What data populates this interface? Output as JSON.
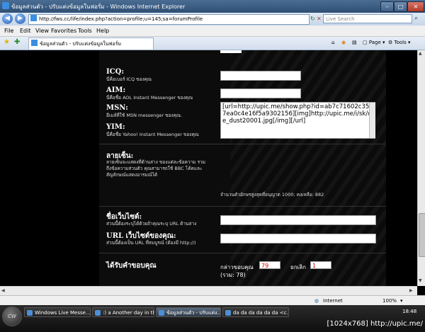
{
  "window": {
    "title": "ข้อมูลส่วนตัว - ปรับแต่งข้อมูลในฟอรั่ม - Windows Internet Explorer"
  },
  "addressbar": {
    "url": "http://fws.cc/life/index.php?action=profile;u=145;sa=forumProfile",
    "search_placeholder": "Live Search"
  },
  "menubar": {
    "items": [
      "File",
      "Edit",
      "View",
      "Favorites",
      "Tools",
      "Help"
    ]
  },
  "tabbar": {
    "tab_title": "ข้อมูลส่วนตัว - ปรับแต่งข้อมูลในฟอรั่ม",
    "page_label": "Page",
    "tools_label": "Tools"
  },
  "form": {
    "icq": {
      "label": "ICQ:",
      "desc": "นี่คือเบอร์ ICQ ของคุณ"
    },
    "aim": {
      "label": "AIM:",
      "desc": "นี่คือชื่อ AOL Instant Messenger ของคุณ"
    },
    "msn": {
      "label": "MSN:",
      "desc": "อีเมล์ที่ใช้ MSN messenger ของคุณ."
    },
    "yim": {
      "label": "YIM:",
      "desc": "นี่คือชื่อ Yahoo! Instant Messenger ของคุณ"
    },
    "signature": {
      "label": "ลายเซ็น:",
      "desc_lines": [
        "ลายเซ็นจะแสดงที่ด้านล่าง ของแต่ละข้อความ รวม",
        "ถึงข้อความส่วนตัว คุณสามารถใช้ BBC โค้ดและ",
        "สัญลักษณ์แสดงอารมณ์ได้"
      ],
      "value": "[url=http://upic.me/show.php?id=ab7c71602c35d7ea0c4e16f5a9302156][img]http://upic.me/i/sk/de_dust20001.jpg[/img][/url]",
      "limit_text": "จำนวนตัวอักษรสูงสุดที่อนุญาต 1000; คงเหลือ: 882"
    },
    "website_title": {
      "label": "ชื่อเว็บไซต์:",
      "desc": "ส่วนนี้ต้องระบุได้ด้วยถ้าคุณระบุ URL ด้านล่าง"
    },
    "website_url": {
      "label": "URL เว็บไซต์ของคุณ:",
      "desc": "ส่วนนี้ต้องเป็น URL ที่สมบูรณ์ (ต้องมี http://)"
    },
    "karma": {
      "label": "ได้รับคำขอบคุณ",
      "applaud_label": "กล่าวขอบคุณ",
      "applaud_value": "79",
      "smite_label": "ยกเลิก",
      "smite_value": "1",
      "total": "(รวม: 78)"
    }
  },
  "statusbar": {
    "zone": "Internet",
    "zoom": "100%"
  },
  "taskbar": {
    "start": "CW",
    "tasks": [
      "Windows Live Messe...",
      ":) a Another day in th...",
      "ข้อมูลส่วนตัว - ปรับแต่ง...",
      "da da da da da da <c..."
    ],
    "clock": "18:48"
  },
  "credit": "[1024x768] http://upic.me/"
}
